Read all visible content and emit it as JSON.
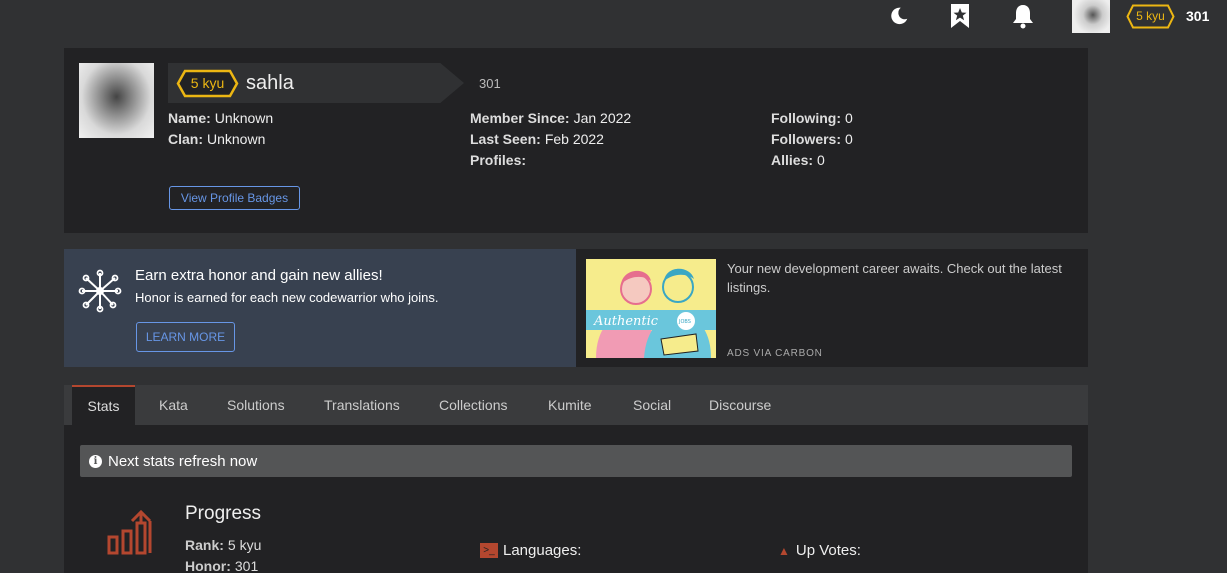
{
  "topnav": {
    "theme_icon": "moon-icon",
    "bookmark_icon": "bookmark-star-icon",
    "notification_icon": "bell-icon",
    "rank": "5 kyu",
    "honor": "301"
  },
  "profile": {
    "rank": "5 kyu",
    "username": "sahla",
    "honor": "301",
    "left": [
      {
        "label": "Name:",
        "value": "Unknown"
      },
      {
        "label": "Clan:",
        "value": "Unknown"
      }
    ],
    "middle": [
      {
        "label": "Member Since:",
        "value": "Jan 2022"
      },
      {
        "label": "Last Seen:",
        "value": "Feb 2022"
      },
      {
        "label": "Profiles:",
        "value": ""
      }
    ],
    "right": [
      {
        "label": "Following:",
        "value": "0"
      },
      {
        "label": "Followers:",
        "value": "0"
      },
      {
        "label": "Allies:",
        "value": "0"
      }
    ],
    "badges_button": "View Profile Badges"
  },
  "promo": {
    "title": "Earn extra honor and gain new allies!",
    "subtitle": "Honor is earned for each new codewarrior who joins.",
    "button": "LEARN MORE"
  },
  "ad": {
    "image_text": "Authentic",
    "image_badge": "JOBS",
    "text": "Your new development career awaits. Check out the latest listings.",
    "via": "ADS VIA CARBON"
  },
  "tabs": [
    "Stats",
    "Kata",
    "Solutions",
    "Translations",
    "Collections",
    "Kumite",
    "Social",
    "Discourse"
  ],
  "stats": {
    "notice": "Next stats refresh now",
    "progress_title": "Progress",
    "rank_label": "Rank:",
    "rank_value": "5 kyu",
    "honor_label": "Honor:",
    "honor_value": "301",
    "languages_label": "Languages:",
    "upvotes_label": "Up Votes:"
  },
  "colors": {
    "accent": "#b4472f",
    "rank_yellow": "#ecb613",
    "link_blue": "#6796e6"
  }
}
